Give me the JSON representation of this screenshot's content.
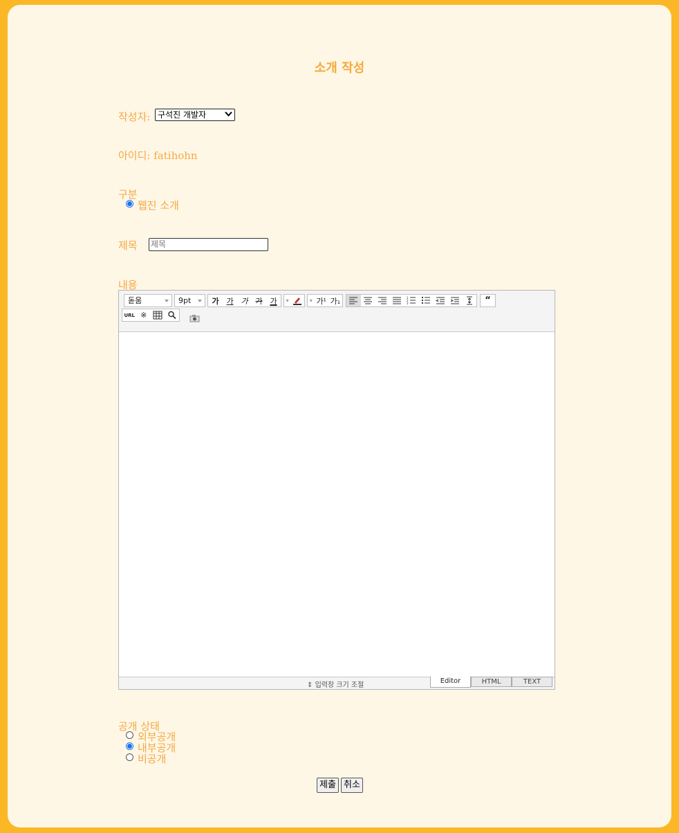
{
  "page_title": "소개 작성",
  "author": {
    "label": "작성자:",
    "selected": "구석진 개발자"
  },
  "user_id": {
    "label": "아이디:",
    "value": "fatihohn"
  },
  "category": {
    "label": "구분",
    "options": [
      {
        "label": "웹진 소개",
        "checked": true
      }
    ]
  },
  "title_field": {
    "label": "제목",
    "placeholder": "제목"
  },
  "content": {
    "label": "내용"
  },
  "editor": {
    "font_family": "돋움",
    "font_size": "9pt",
    "format_buttons": [
      "가",
      "가",
      "가",
      "가",
      "가"
    ],
    "script_buttons": [
      "가¹",
      "가₁"
    ],
    "link_button": "URL",
    "resize_label": "입력창 크기 조절",
    "modes": [
      "Editor",
      "HTML",
      "TEXT"
    ],
    "active_mode": "Editor"
  },
  "visibility": {
    "label": "공개 상태",
    "options": [
      {
        "label": "외부공개",
        "checked": false
      },
      {
        "label": "내부공개",
        "checked": true
      },
      {
        "label": "비공개",
        "checked": false
      }
    ]
  },
  "actions": {
    "submit": "제출",
    "cancel": "취소"
  },
  "colors": {
    "background": "#fbb726",
    "card": "#fef7e6",
    "label": "#f5a845"
  }
}
